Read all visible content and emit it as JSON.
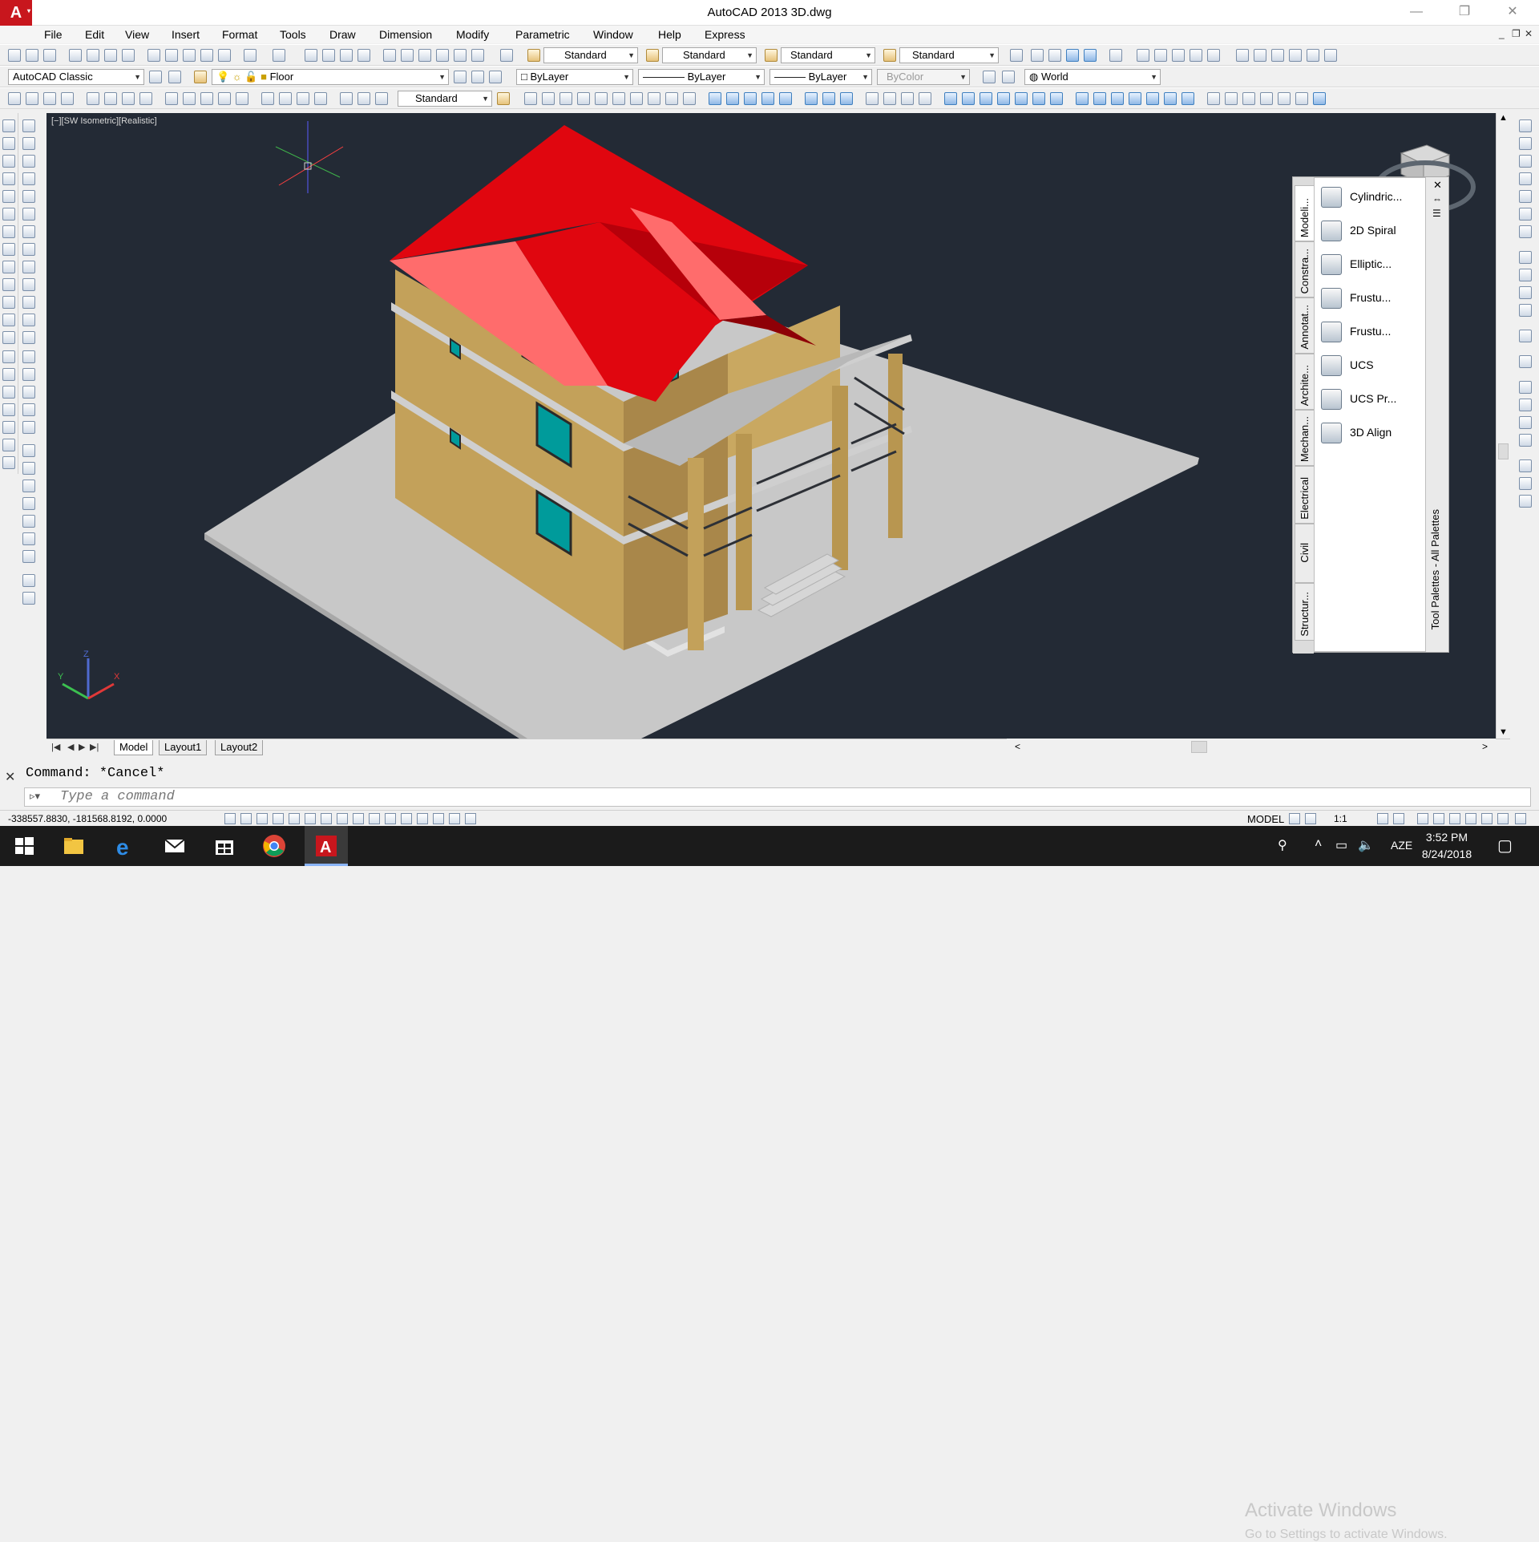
{
  "window": {
    "title": "AutoCAD 2013    3D.dwg",
    "app_logo": "A",
    "minimize": "—",
    "restore": "❐",
    "close": "✕"
  },
  "menu": {
    "items": [
      "File",
      "Edit",
      "View",
      "Insert",
      "Format",
      "Tools",
      "Draw",
      "Dimension",
      "Modify",
      "Parametric",
      "Window",
      "Help",
      "Express"
    ]
  },
  "toolbar1": {
    "text_style": "Standard",
    "dim_style": "Standard",
    "table_style": "Standard",
    "mleader_style": "Standard"
  },
  "toolbar2": {
    "workspace": "AutoCAD Classic",
    "layer": "Floor",
    "color": "ByLayer",
    "linetype": "ByLayer",
    "lineweight": "ByLayer",
    "plotstyle": "ByColor",
    "ucs": "World"
  },
  "toolbar3": {
    "dim_style": "Standard"
  },
  "viewport": {
    "label": "[−][SW Isometric][Realistic]"
  },
  "palette": {
    "title": "Tool Palettes - All Palettes",
    "close": "✕",
    "tabs": [
      "Modeli...",
      "Constra...",
      "Annotat...",
      "Archite...",
      "Mechan...",
      "Electrical",
      "Civil",
      "Structur..."
    ],
    "items": [
      "Cylindric...",
      "2D Spiral",
      "Elliptic...",
      "Frustu...",
      "Frustu...",
      "UCS",
      "UCS Pr...",
      "3D Align"
    ]
  },
  "layout_tabs": [
    "Model",
    "Layout1",
    "Layout2"
  ],
  "command": {
    "history": "Command: *Cancel*",
    "placeholder": "Type a command",
    "close": "✕"
  },
  "watermark": {
    "line1": "Activate Windows",
    "line2": "Go to Settings to activate Windows."
  },
  "status": {
    "coordinates": "-338557.8830, -181568.8192, 0.0000",
    "model": "MODEL",
    "scale": "1:1"
  },
  "taskbar": {
    "language": "AZE",
    "time": "3:52 PM",
    "date": "8/24/2018"
  }
}
